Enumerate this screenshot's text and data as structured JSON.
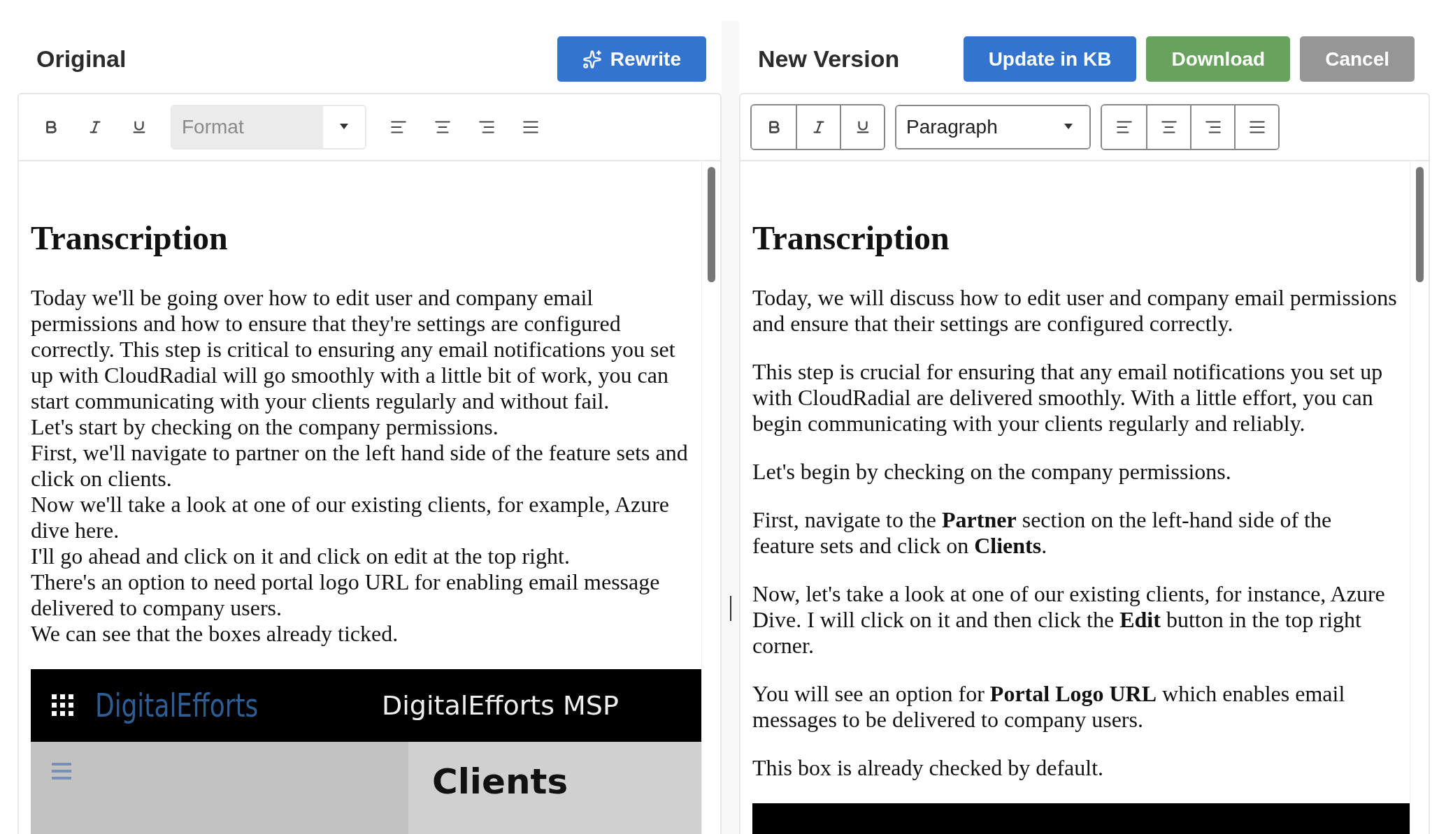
{
  "panels": [
    {
      "title": "Original",
      "buttons": [
        {
          "label": "Rewrite",
          "kind": "ai"
        }
      ],
      "editor": {
        "read_only": true,
        "format": {
          "placeholder": "Format"
        },
        "heading": "Transcription",
        "paragraphs": [
          {
            "lines": [
              "Today we'll be going over how to edit user and company email permissions and how to ensure that they're settings are configured correctly. This step is critical to ensuring any email notifications you set up with CloudRadial will go smoothly with a little bit of work, you can start communicating with your clients regularly and without fail.",
              "Let's start by checking on the company permissions.",
              "First, we'll navigate to partner on the left hand side of the feature sets and click on clients.",
              "Now we'll take a look at one of our existing clients, for example, Azure dive here.",
              "I'll go ahead and click on it and click on edit at the top right.",
              "There's an option to need portal logo URL for enabling email message delivered to company users.",
              "We can see that the boxes already ticked."
            ]
          }
        ],
        "embedded": {
          "kind": "screenshot",
          "brand": "DigitalEfforts",
          "account": "DigitalEfforts MSP",
          "page_title": "Clients"
        }
      }
    },
    {
      "title": "New Version",
      "buttons": [
        {
          "label": "Update in KB",
          "kind": "primary"
        },
        {
          "label": "Download",
          "kind": "success"
        },
        {
          "label": "Cancel",
          "kind": "secondary"
        }
      ],
      "editor": {
        "read_only": false,
        "format": {
          "value": "Paragraph"
        },
        "heading": "Transcription",
        "paragraphs": [
          {
            "lines": [
              "Today, we will discuss how to edit user and company email permissions and ensure that their settings are configured correctly."
            ]
          },
          {
            "lines": [
              "This step is crucial for ensuring that any email notifications you set up with CloudRadial are delivered smoothly. With a little effort, you can begin communicating with your clients regularly and reliably."
            ]
          },
          {
            "lines": [
              "Let's begin by checking on the company permissions."
            ]
          },
          {
            "lines": [
              "First, navigate to the **Partner** section on the left-hand side of the feature sets and click on **Clients**."
            ]
          },
          {
            "lines": [
              "Now, let's take a look at one of our existing clients, for instance, Azure Dive. I will click on it and then click the **Edit** button in the top right corner."
            ]
          },
          {
            "lines": [
              "You will see an option for **Portal Logo URL** which enables email messages to be delivered to company users."
            ]
          },
          {
            "lines": [
              "This box is already checked by default."
            ]
          }
        ],
        "embedded": {
          "kind": "screenshot"
        }
      }
    }
  ]
}
